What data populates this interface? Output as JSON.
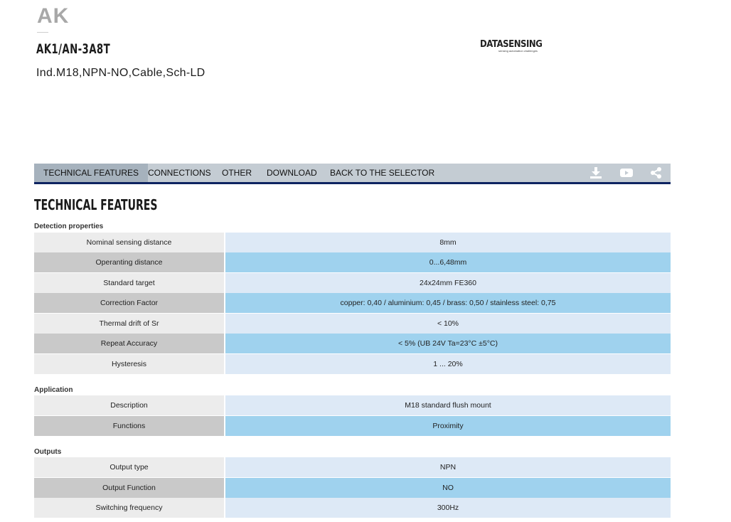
{
  "header": {
    "family": "AK",
    "model": "AK1/AN-3A8T",
    "description": "Ind.M18,NPN-NO,Cable,Sch-LD",
    "logo_brand": "DATASENSING",
    "logo_tagline": "sensing automation challenges"
  },
  "tabs": [
    {
      "label": "TECHNICAL FEATURES",
      "active": true
    },
    {
      "label": "CONNECTIONS",
      "active": false
    },
    {
      "label": "OTHER",
      "active": false
    },
    {
      "label": "DOWNLOAD",
      "active": false
    },
    {
      "label": "BACK TO THE SELECTOR",
      "active": false
    }
  ],
  "toolbar_icons": [
    "download-icon",
    "youtube-icon",
    "share-icon"
  ],
  "section_title": "TECHNICAL FEATURES",
  "groups": [
    {
      "title": "Detection properties",
      "rows": [
        {
          "key": "Nominal sensing distance",
          "value": "8mm"
        },
        {
          "key": "Operanting distance",
          "value": "0...6,48mm"
        },
        {
          "key": "Standard target",
          "value": "24x24mm FE360"
        },
        {
          "key": "Correction Factor",
          "value": "copper: 0,40 / aluminium: 0,45 / brass: 0,50 / stainless steel: 0,75"
        },
        {
          "key": "Thermal drift of Sr",
          "value": "< 10%"
        },
        {
          "key": "Repeat Accuracy",
          "value": "< 5% (UB 24V Ta=23°C ±5°C)"
        },
        {
          "key": "Hysteresis",
          "value": "1 ... 20%"
        }
      ]
    },
    {
      "title": "Application",
      "rows": [
        {
          "key": "Description",
          "value": "M18 standard flush mount"
        },
        {
          "key": "Functions",
          "value": "Proximity"
        }
      ]
    },
    {
      "title": "Outputs",
      "rows": [
        {
          "key": "Output type",
          "value": "NPN"
        },
        {
          "key": "Output Function",
          "value": "NO"
        },
        {
          "key": "Switching frequency",
          "value": "300Hz"
        }
      ]
    }
  ],
  "colors": {
    "tab_bar": "#c4ccd3",
    "tab_active": "#a6b2bd",
    "tab_underline": "#0e2461",
    "row_key_light": "#ececec",
    "row_key_dark": "#c9c9c9",
    "row_value_light": "#dde9f6",
    "row_value_dark": "#9fd2ee"
  }
}
